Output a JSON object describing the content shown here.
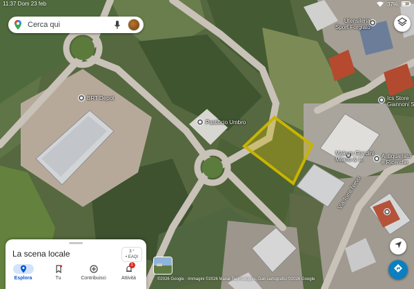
{
  "status_bar": {
    "time": "11:37",
    "day": "Dom 23 feb",
    "battery": "37%"
  },
  "search": {
    "placeholder": "Cerca qui"
  },
  "map_labels": {
    "brt_depot": "BRT Depot",
    "pastificio": "Pastificio Umbro",
    "utensileria": "Utensileria\nSport Forgiato",
    "ics_store": "Ics Store\nGiannoni Srl",
    "makers": "Makers Giardini\nMilano & C.",
    "antiquariato": "Antiquariato\ne Ricerche",
    "street": "Via Torre Nievo"
  },
  "sheet": {
    "title": "La scena locale",
    "aqi_value": "3 °",
    "aqi_label": "• EAQI"
  },
  "tabs": [
    {
      "label": "Esplora",
      "icon": "location-pin-icon",
      "active": true
    },
    {
      "label": "Tu",
      "icon": "bookmark-icon",
      "active": false
    },
    {
      "label": "Contribuisci",
      "icon": "add-circle-icon",
      "active": false
    },
    {
      "label": "Attività",
      "icon": "notifications-icon",
      "active": false,
      "badge": "1"
    }
  ],
  "copyright": "©2026 Google · Immagini ©2026 Maxar Technologies, Dati cartografici ©2026 Google",
  "colors": {
    "accent": "#0b57d0",
    "highlight_area": "#c8b400",
    "fab_direction": "#0b7fbf"
  }
}
